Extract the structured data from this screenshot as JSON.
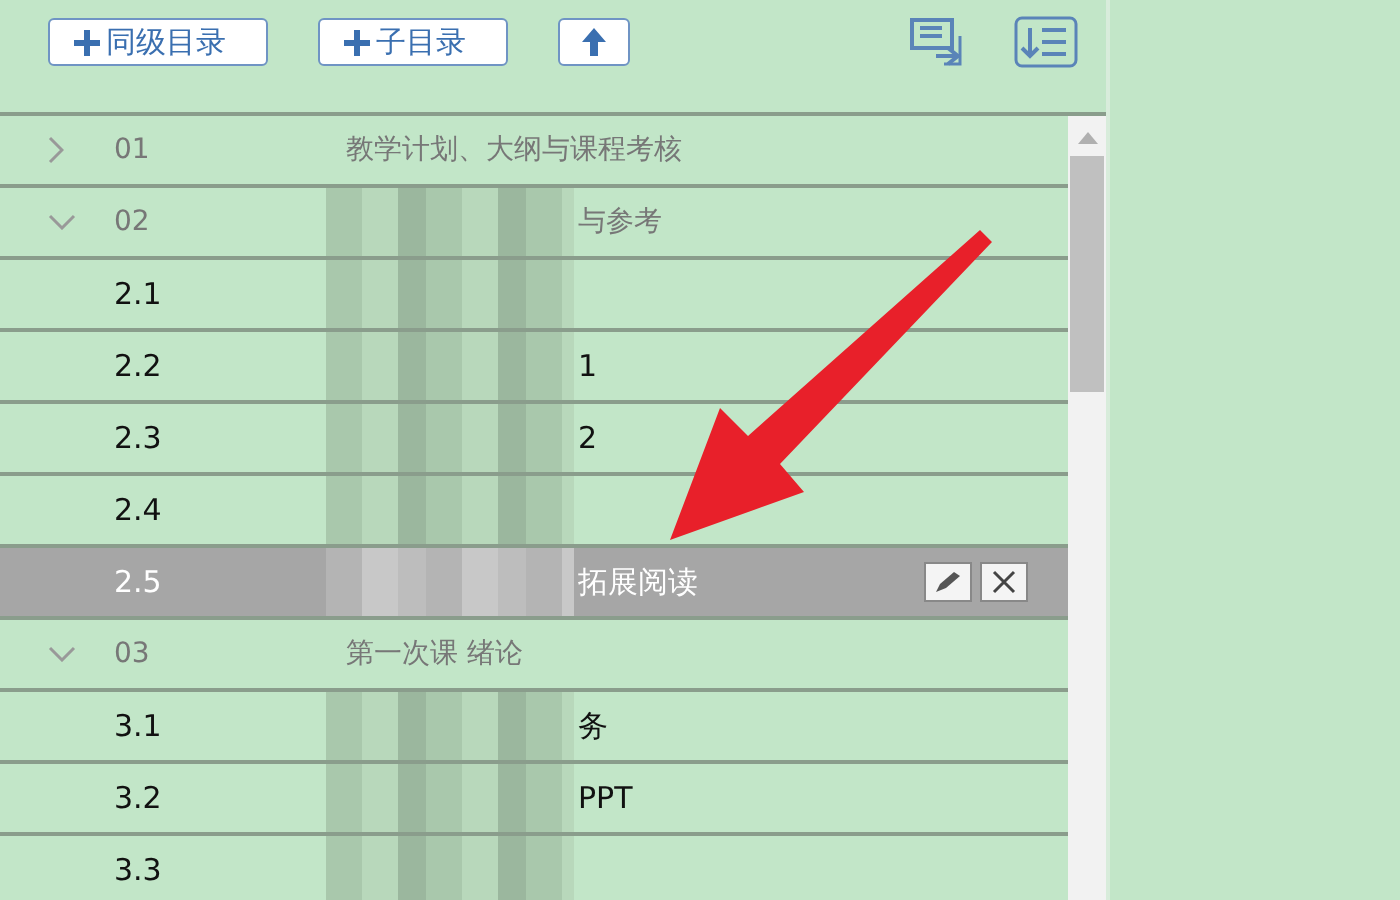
{
  "toolbar": {
    "buttons": [
      {
        "kind": "add",
        "label": "同级目录"
      },
      {
        "kind": "add",
        "label": "子目录"
      },
      {
        "kind": "up"
      }
    ]
  },
  "outline": [
    {
      "number": "01",
      "title": "教学计划、大纲与课程考核",
      "redacted": false,
      "expanded": false
    },
    {
      "number": "02",
      "title": "与参考",
      "redacted": true,
      "expanded": true,
      "children": [
        {
          "number": "2.1",
          "redacted": true,
          "selected": false
        },
        {
          "number": "2.2",
          "title": "1",
          "redacted": true,
          "selected": false
        },
        {
          "number": "2.3",
          "title": "2",
          "redacted": true,
          "selected": false
        },
        {
          "number": "2.4",
          "redacted": true,
          "selected": false
        },
        {
          "number": "2.5",
          "title": "拓展阅读",
          "redacted": true,
          "selected": true
        }
      ]
    },
    {
      "number": "03",
      "title": "第一次课 绪论",
      "redacted": false,
      "expanded": true,
      "children": [
        {
          "number": "3.1",
          "title": "务",
          "redacted": true,
          "selected": false
        },
        {
          "number": "3.2",
          "title": "PPT",
          "redacted": true,
          "selected": false
        },
        {
          "number": "3.3",
          "redacted": true,
          "selected": false
        }
      ]
    }
  ]
}
